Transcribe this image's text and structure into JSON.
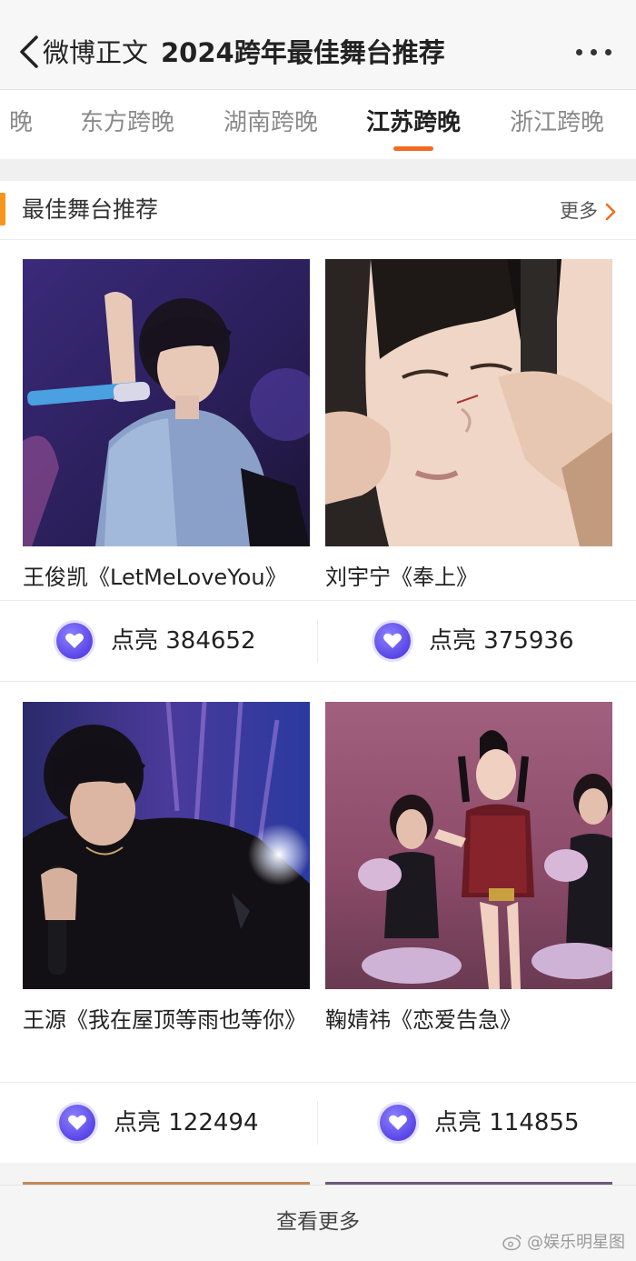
{
  "header": {
    "back_label": "微博正文",
    "title": "2024跨年最佳舞台推荐"
  },
  "tabs": [
    {
      "label": "晚"
    },
    {
      "label": "东方跨晚"
    },
    {
      "label": "湖南跨晚"
    },
    {
      "label": "江苏跨晚",
      "active": true
    },
    {
      "label": "浙江跨晚"
    }
  ],
  "section": {
    "title": "最佳舞台推荐",
    "more_label": "更多"
  },
  "cards": [
    {
      "caption": "王俊凯《LetMeLoveYou》",
      "likes": "点亮 384652"
    },
    {
      "caption": "刘宇宁《奉上》",
      "likes": "点亮 375936"
    },
    {
      "caption": "王源《我在屋顶等雨也等你》",
      "likes": "点亮 122494"
    },
    {
      "caption": "鞠婧祎《恋爱告急》",
      "likes": "点亮 114855"
    }
  ],
  "footer": {
    "view_more": "查看更多",
    "watermark": "@娱乐明星图"
  },
  "colors": {
    "accent_orange": "#f36b21",
    "section_accent": "#f7941d",
    "like_badge": "#5a45e6"
  }
}
